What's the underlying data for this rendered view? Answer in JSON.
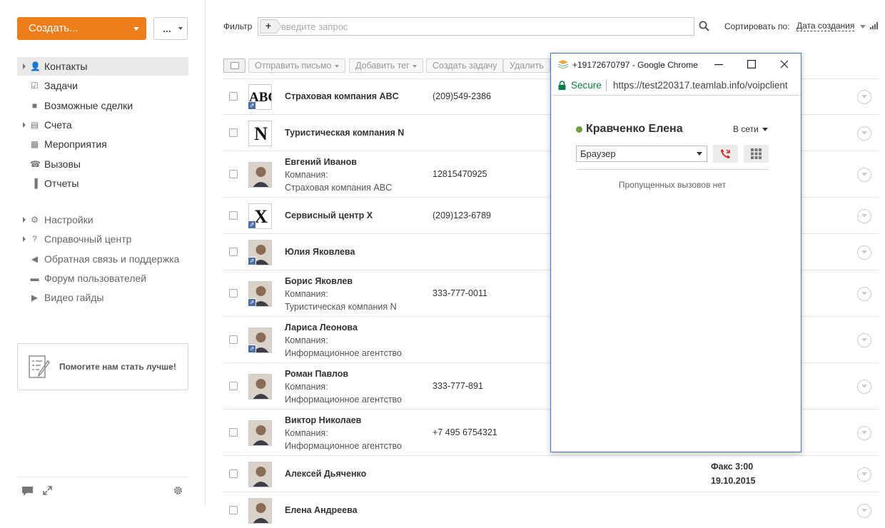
{
  "sidebar": {
    "create_label": "Создать...",
    "more_label": "...",
    "nav": [
      {
        "label": "Контакты",
        "icon": "contacts-icon",
        "arrow": true,
        "active": true
      },
      {
        "label": "Задачи",
        "icon": "tasks-icon",
        "arrow": false
      },
      {
        "label": "Возможные сделки",
        "icon": "deals-icon",
        "arrow": false
      },
      {
        "label": "Счета",
        "icon": "invoices-icon",
        "arrow": true
      },
      {
        "label": "Мероприятия",
        "icon": "events-icon",
        "arrow": false
      },
      {
        "label": "Вызовы",
        "icon": "phone-icon",
        "arrow": false
      },
      {
        "label": "Отчеты",
        "icon": "reports-icon",
        "arrow": false
      }
    ],
    "nav2": [
      {
        "label": "Настройки",
        "icon": "gear-icon",
        "arrow": true
      },
      {
        "label": "Справочный центр",
        "icon": "help-icon",
        "arrow": true
      },
      {
        "label": "Обратная связь и поддержка",
        "icon": "megaphone-icon",
        "arrow": false
      },
      {
        "label": "Форум пользователей",
        "icon": "forum-icon",
        "arrow": false
      },
      {
        "label": "Видео гайды",
        "icon": "video-icon",
        "arrow": false
      }
    ],
    "help_box_label": "Помогите нам стать лучше!"
  },
  "filter": {
    "label": "Фильтр",
    "placeholder": "введите запрос",
    "sort_label": "Сортировать по:",
    "sort_value": "Дата создания"
  },
  "toolbar": {
    "send_email": "Отправить письмо",
    "add_tag": "Добавить тег",
    "create_task": "Создать задачу",
    "delete": "Удалить"
  },
  "contacts": [
    {
      "name": "Страховая компания ABC",
      "avatar": "ABC",
      "company_label": "",
      "company": "",
      "phone": "(209)549-2386",
      "badge": true,
      "extra1": "",
      "extra2": ""
    },
    {
      "name": "Туристическая компания N",
      "avatar": "N",
      "company_label": "",
      "company": "",
      "phone": "",
      "badge": false,
      "extra1": "",
      "extra2": ""
    },
    {
      "name": "Евгений Иванов",
      "avatar": "photo",
      "company_label": "Компания:",
      "company": "Страховая компания ABC",
      "phone": "12815470925",
      "badge": false,
      "extra1": "",
      "extra2": ""
    },
    {
      "name": "Сервисный центр X",
      "avatar": "X",
      "company_label": "",
      "company": "",
      "phone": "(209)123-6789",
      "badge": true,
      "extra1": "",
      "extra2": ""
    },
    {
      "name": "Юлия Яковлева",
      "avatar": "photo",
      "company_label": "",
      "company": "",
      "phone": "",
      "badge": true,
      "extra1": "",
      "extra2": ""
    },
    {
      "name": "Борис Яковлев",
      "avatar": "photo",
      "company_label": "Компания:",
      "company": "Туристическая компания N",
      "phone": "333-777-0011",
      "badge": true,
      "extra1": "",
      "extra2": ""
    },
    {
      "name": "Лариса Леонова",
      "avatar": "photo",
      "company_label": "Компания:",
      "company": "Информационное агентство",
      "phone": "",
      "badge": true,
      "extra1": "",
      "extra2": ""
    },
    {
      "name": "Роман Павлов",
      "avatar": "photo",
      "company_label": "Компания:",
      "company": "Информационное агентство",
      "phone": "333-777-891",
      "badge": false,
      "extra1": "",
      "extra2": ""
    },
    {
      "name": "Виктор Николаев",
      "avatar": "photo",
      "company_label": "Компания:",
      "company": "Информационное агентство",
      "phone": "+7 495 6754321",
      "badge": false,
      "extra1": "",
      "extra2": ""
    },
    {
      "name": "Алексей Дьяченко",
      "avatar": "photo",
      "company_label": "",
      "company": "",
      "phone": "",
      "badge": false,
      "extra1": "Факс 3:00",
      "extra2": "19.10.2015"
    },
    {
      "name": "Елена Андреева",
      "avatar": "photo",
      "company_label": "",
      "company": "",
      "phone": "",
      "badge": false,
      "extra1": "",
      "extra2": ""
    }
  ],
  "popup": {
    "window_title": "+19172670797 - Google Chrome",
    "secure_label": "Secure",
    "url": "https://test220317.teamlab.info/voipclient",
    "contact_name": "Кравченко Елена",
    "status": "В сети",
    "device": "Браузер",
    "empty_message": "Пропущенных вызовов нет",
    "status_color": "#6aa035"
  },
  "colors": {
    "accent": "#ef7d1c",
    "popup_border": "#3b7bc8",
    "call_red": "#d0312d"
  }
}
